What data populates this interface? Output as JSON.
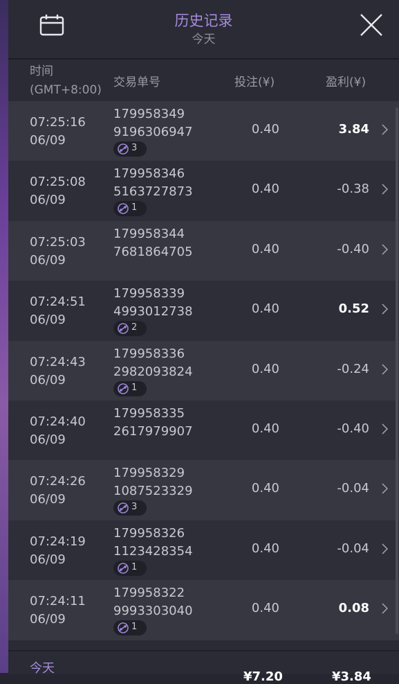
{
  "header": {
    "title": "历史记录",
    "subtitle": "今天"
  },
  "columns": {
    "time_line1": "时间",
    "time_line2": "(GMT+8:00)",
    "order": "交易单号",
    "bet": "投注(¥)",
    "profit": "盈利(¥)"
  },
  "rows": [
    {
      "time": "07:25:16",
      "date": "06/09",
      "order1": "179958349",
      "order2": "9196306947",
      "bet": "0.40",
      "profit": "3.84",
      "positive": true,
      "badge": "3"
    },
    {
      "time": "07:25:08",
      "date": "06/09",
      "order1": "179958346",
      "order2": "5163727873",
      "bet": "0.40",
      "profit": "-0.38",
      "positive": false,
      "badge": "1"
    },
    {
      "time": "07:25:03",
      "date": "06/09",
      "order1": "179958344",
      "order2": "7681864705",
      "bet": "0.40",
      "profit": "-0.40",
      "positive": false,
      "badge": null
    },
    {
      "time": "07:24:51",
      "date": "06/09",
      "order1": "179958339",
      "order2": "4993012738",
      "bet": "0.40",
      "profit": "0.52",
      "positive": true,
      "badge": "2"
    },
    {
      "time": "07:24:43",
      "date": "06/09",
      "order1": "179958336",
      "order2": "2982093824",
      "bet": "0.40",
      "profit": "-0.24",
      "positive": false,
      "badge": "1"
    },
    {
      "time": "07:24:40",
      "date": "06/09",
      "order1": "179958335",
      "order2": "2617979907",
      "bet": "0.40",
      "profit": "-0.40",
      "positive": false,
      "badge": null
    },
    {
      "time": "07:24:26",
      "date": "06/09",
      "order1": "179958329",
      "order2": "1087523329",
      "bet": "0.40",
      "profit": "-0.04",
      "positive": false,
      "badge": "3"
    },
    {
      "time": "07:24:19",
      "date": "06/09",
      "order1": "179958326",
      "order2": "1123428354",
      "bet": "0.40",
      "profit": "-0.04",
      "positive": false,
      "badge": "1"
    },
    {
      "time": "07:24:11",
      "date": "06/09",
      "order1": "179958322",
      "order2": "9993303040",
      "bet": "0.40",
      "profit": "0.08",
      "positive": true,
      "badge": "1"
    }
  ],
  "footer": {
    "label": "今天",
    "total_bet": "¥7.20",
    "total_profit": "¥3.84"
  },
  "colors": {
    "accent": "#a78bdb",
    "panel": "#2a2b35",
    "row_light": "#363741",
    "row_dark": "#2d2e38"
  }
}
